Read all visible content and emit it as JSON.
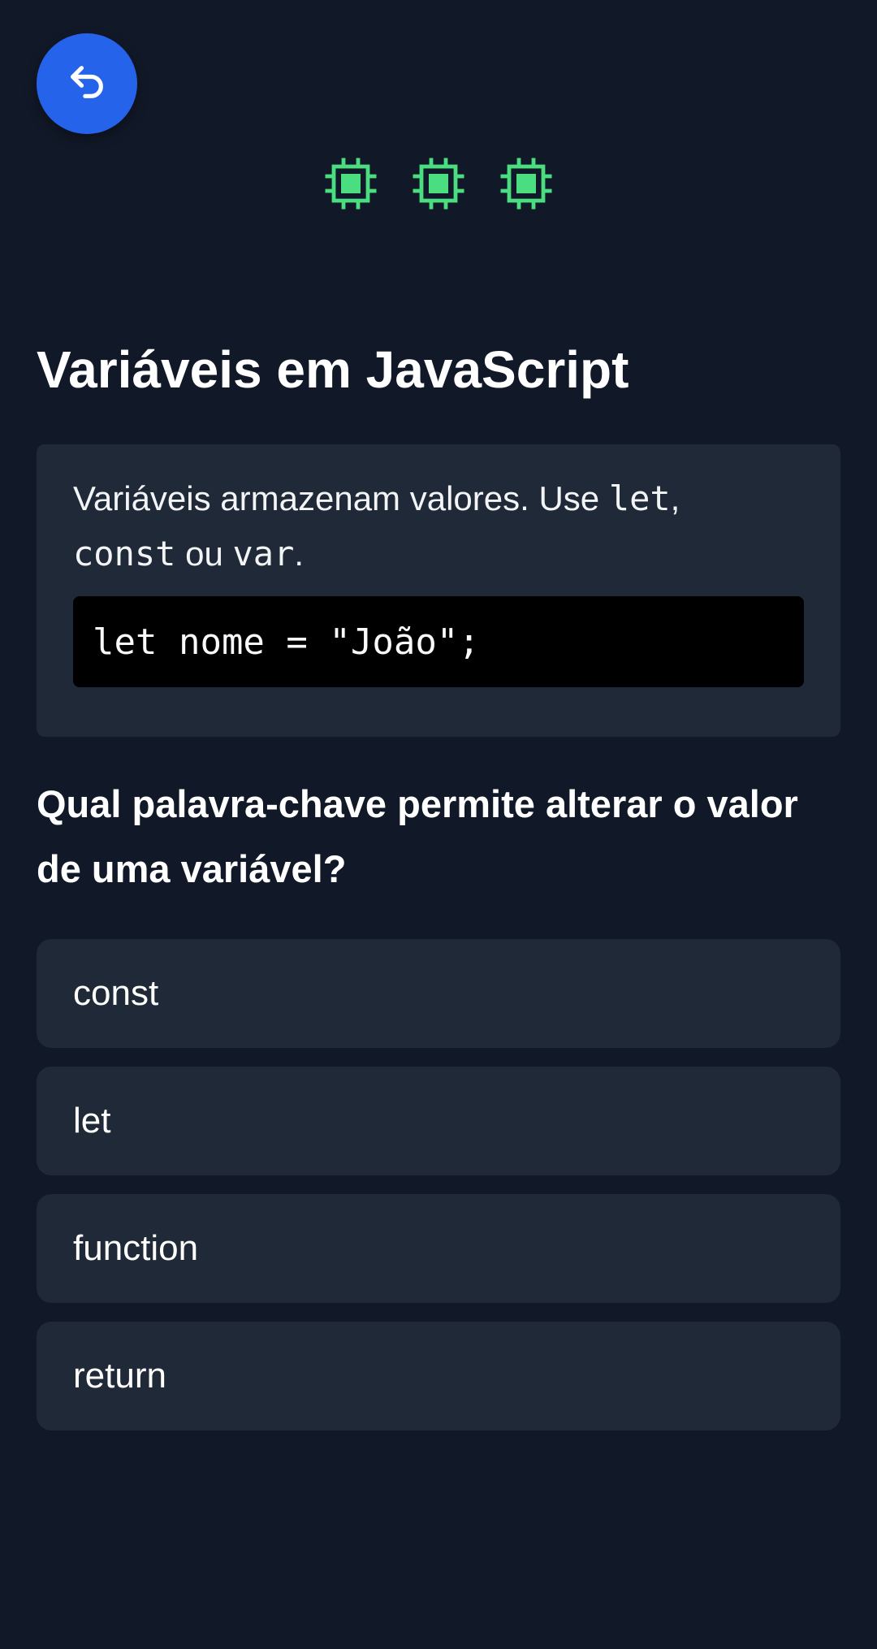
{
  "nav": {
    "back_icon": "undo-arrow-icon",
    "accent_color": "#2563eb"
  },
  "lives": {
    "icon": "cpu-chip-icon",
    "count": 3,
    "color": "#4ade80"
  },
  "lesson": {
    "title": "Variáveis em JavaScript",
    "text_intro": "Variáveis armazenam valores. Use ",
    "keyword_let": "let",
    "sep_comma": ",",
    "keyword_const": "const",
    "sep_or": " ou ",
    "keyword_var": "var",
    "end_period": ".",
    "code_example": "let nome = \"João\";"
  },
  "quiz": {
    "question": "Qual palavra-chave permite alterar o valor de uma variável?",
    "options": [
      {
        "label": "const"
      },
      {
        "label": "let"
      },
      {
        "label": "function"
      },
      {
        "label": "return"
      }
    ]
  }
}
